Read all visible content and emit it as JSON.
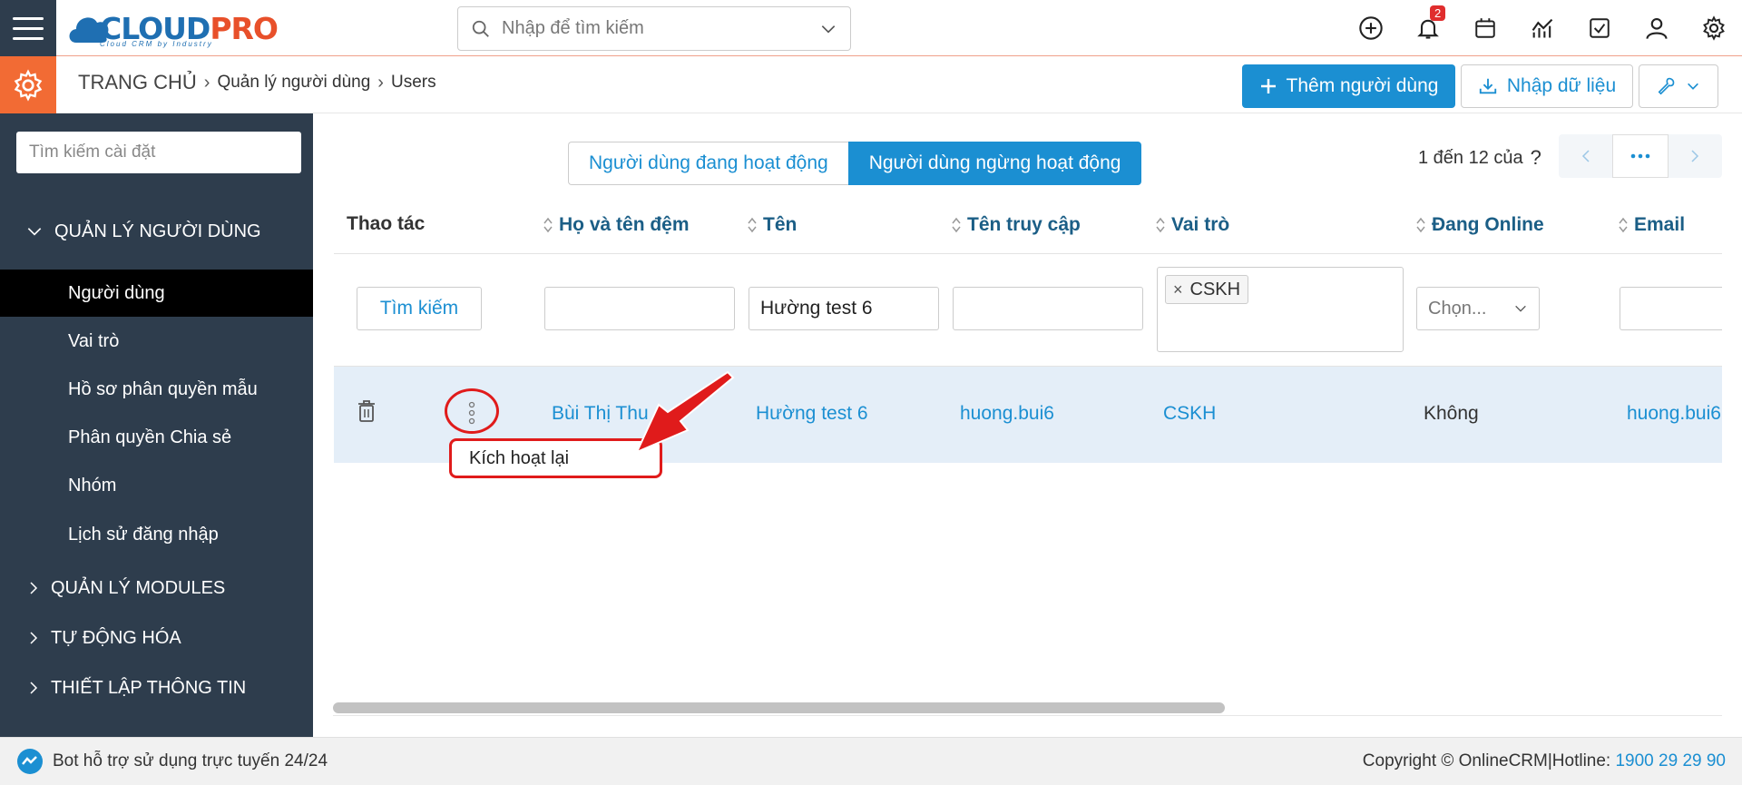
{
  "brand": {
    "name_cloud": "CLOUD",
    "name_pro": "PRO",
    "tagline": "Cloud CRM by Industry"
  },
  "search": {
    "placeholder": "Nhập để tìm kiếm"
  },
  "notifications": {
    "count": "2"
  },
  "breadcrumb": {
    "home": "TRANG CHỦ",
    "level1": "Quản lý người dùng",
    "level2": "Users"
  },
  "actions": {
    "add_user": "Thêm người dùng",
    "import": "Nhập dữ liệu"
  },
  "sidebar": {
    "search_placeholder": "Tìm kiếm cài đặt",
    "section_users": "QUẢN LÝ NGƯỜI DÙNG",
    "items": [
      {
        "label": "Người dùng"
      },
      {
        "label": "Vai trò"
      },
      {
        "label": "Hồ sơ phân quyền mẫu"
      },
      {
        "label": "Phân quyền Chia sẻ"
      },
      {
        "label": "Nhóm"
      },
      {
        "label": "Lịch sử đăng nhập"
      }
    ],
    "sections": [
      {
        "label": "QUẢN LÝ MODULES"
      },
      {
        "label": "TỰ ĐỘNG HÓA"
      },
      {
        "label": "THIẾT LẬP THÔNG TIN"
      }
    ]
  },
  "tabs": {
    "active_users": "Người dùng đang hoạt động",
    "inactive_users": "Người dùng ngừng hoạt động"
  },
  "pager": {
    "text": "1 đến 12 của",
    "help": "?"
  },
  "table": {
    "headers": {
      "actions": "Thao tác",
      "last_name": "Họ và tên đệm",
      "first_name": "Tên",
      "username": "Tên truy cập",
      "role": "Vai trò",
      "online": "Đang Online",
      "email": "Email"
    },
    "filters": {
      "search_button": "Tìm kiếm",
      "last_name": "",
      "first_name": "Hường test 6",
      "username": "",
      "role_chip": "CSKH",
      "online_placeholder": "Chọn...",
      "email": ""
    },
    "rows": [
      {
        "last_name": "Bùi Thị Thu",
        "first_name": "Hường test 6",
        "username": "huong.bui6",
        "role": "CSKH",
        "online": "Không",
        "email": "huong.bui6"
      }
    ]
  },
  "context_menu": {
    "reactivate": "Kích hoạt lại"
  },
  "footer": {
    "bot": "Bot hỗ trợ sử dụng trực tuyến 24/24",
    "copyright": "Copyright © OnlineCRM|Hotline: ",
    "hotline": "1900 29 29 90"
  },
  "colors": {
    "primary": "#1b8fd2",
    "sidebar": "#2e3d4d",
    "accent": "#f26b34",
    "annotation": "#e01b1b"
  }
}
